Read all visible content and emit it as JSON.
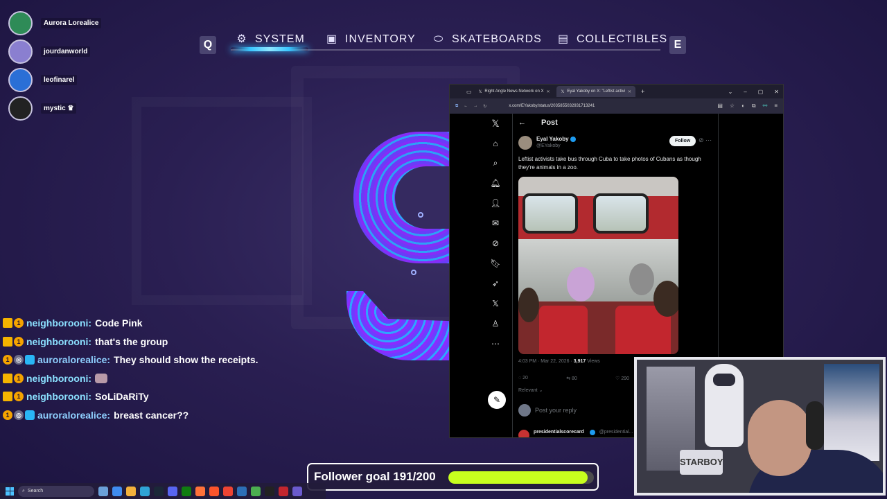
{
  "menu": {
    "left_key": "Q",
    "right_key": "E",
    "items": [
      {
        "label": "SYSTEM",
        "icon": "gear-icon",
        "active": true
      },
      {
        "label": "INVENTORY",
        "icon": "backpack-icon",
        "active": false
      },
      {
        "label": "SKATEBOARDS",
        "icon": "skateboard-icon",
        "active": false
      },
      {
        "label": "COLLECTIBLES",
        "icon": "cards-icon",
        "active": false
      }
    ]
  },
  "viewers": [
    {
      "name": "Aurora Lorealice",
      "color": "#2e8b57"
    },
    {
      "name": "jourdanworld",
      "color": "#8a7fd0"
    },
    {
      "name": "leofinarel",
      "color": "#2a6fd6"
    },
    {
      "name": "mystic ♛",
      "color": "#222"
    }
  ],
  "chat": [
    {
      "badges": [
        "crown",
        "one"
      ],
      "user": "neighborooni:",
      "message": "Code Pink",
      "emote": false
    },
    {
      "badges": [
        "crown",
        "one"
      ],
      "user": "neighborooni:",
      "message": "that's the group",
      "emote": false
    },
    {
      "badges": [
        "one",
        "ring",
        "cube"
      ],
      "user": "auroralorealice:",
      "message": "They should show the receipts.",
      "emote": false
    },
    {
      "badges": [
        "crown",
        "one"
      ],
      "user": "neighborooni:",
      "message": "",
      "emote": true
    },
    {
      "badges": [
        "crown",
        "one"
      ],
      "user": "neighborooni:",
      "message": "SoLiDaRiTy",
      "emote": false
    },
    {
      "badges": [
        "one",
        "ring",
        "cube"
      ],
      "user": "auroralorealice:",
      "message": "breast cancer??",
      "emote": false
    }
  ],
  "browser": {
    "tabs": [
      {
        "title": "Right Angle News Network on X",
        "active": false
      },
      {
        "title": "Eyal Yakoby on X: \"Leftist activi",
        "active": true
      }
    ],
    "url": "x.com/EYakoby/status/2035855032931713241"
  },
  "post": {
    "header": "Post",
    "author_name": "Eyal Yakoby",
    "author_handle": "@EYakoby",
    "follow_label": "Follow",
    "text": "Leftist activists take bus through Cuba to take photos of Cubans as though they're animals in a zoo.",
    "time": "4:03 PM · Mar 22, 2026 ·",
    "views_count": "3,917",
    "views_label": "Views",
    "replies": "20",
    "reposts": "80",
    "likes": "290",
    "sort_label": "Relevant ⌄",
    "reply_placeholder": "Post your reply",
    "next_reply_name": "presidentialscorecard",
    "next_reply_handle": "@presidential..."
  },
  "webcam": {
    "plate_text": "STARBOY"
  },
  "goal": {
    "text": "Follower goal 191/200",
    "current": 191,
    "target": 200
  },
  "taskbar": {
    "search_placeholder": "Search"
  },
  "colors": {
    "accent": "#38c6ff",
    "goal_fill": "#c8ff1e",
    "chat_user": "#8be0ff",
    "x_blue": "#1d9bf0"
  }
}
